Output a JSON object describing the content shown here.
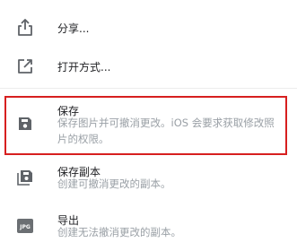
{
  "menu": {
    "share": {
      "label": "分享...",
      "icon": "share-icon"
    },
    "open_with": {
      "label": "打开方式...",
      "icon": "open-external-icon"
    },
    "save": {
      "label": "保存",
      "description": "保存图片并可撤消更改。iOS 会要求获取修改照片的权限。",
      "icon": "floppy-disk-icon"
    },
    "save_copy": {
      "label": "保存副本",
      "description": "创建可撤消更改的副本。",
      "icon": "floppy-disk-copy-icon"
    },
    "export": {
      "label": "导出",
      "description": "创建无法撤消更改的副本。",
      "icon": "jpg-file-icon",
      "icon_text": "JPG"
    }
  },
  "colors": {
    "highlight_border": "#d71f1f",
    "icon": "#5f6368",
    "label": "#202124",
    "description": "#9aa0a6"
  }
}
